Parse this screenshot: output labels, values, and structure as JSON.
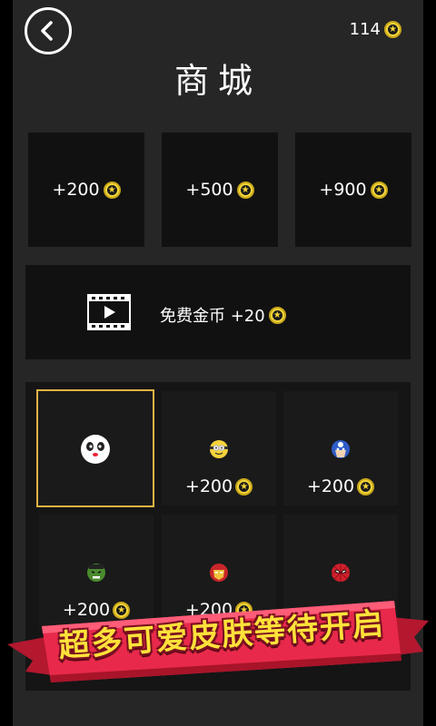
{
  "header": {
    "title": "商城",
    "coin_count": "114"
  },
  "packs": [
    {
      "label": "+200"
    },
    {
      "label": "+500"
    },
    {
      "label": "+900"
    }
  ],
  "free_coins": {
    "label": "免费金币 +20"
  },
  "skins": [
    {
      "name": "panda",
      "price": ""
    },
    {
      "name": "minion",
      "price": "+200"
    },
    {
      "name": "captain",
      "price": "+200"
    },
    {
      "name": "hulk",
      "price": "+200"
    },
    {
      "name": "ironman",
      "price": "+200"
    },
    {
      "name": "spiderman",
      "price": ""
    }
  ],
  "banner": {
    "text": "超多可爱皮肤等待开启"
  },
  "colors": {
    "background": "#262626",
    "tile": "#111111",
    "selected_border": "#e0b341",
    "coin": "#f4d63a",
    "banner_red": "#e8294b",
    "banner_text": "#ffe23a"
  },
  "icons": [
    "back-arrow-icon",
    "coin-icon",
    "video-icon"
  ]
}
